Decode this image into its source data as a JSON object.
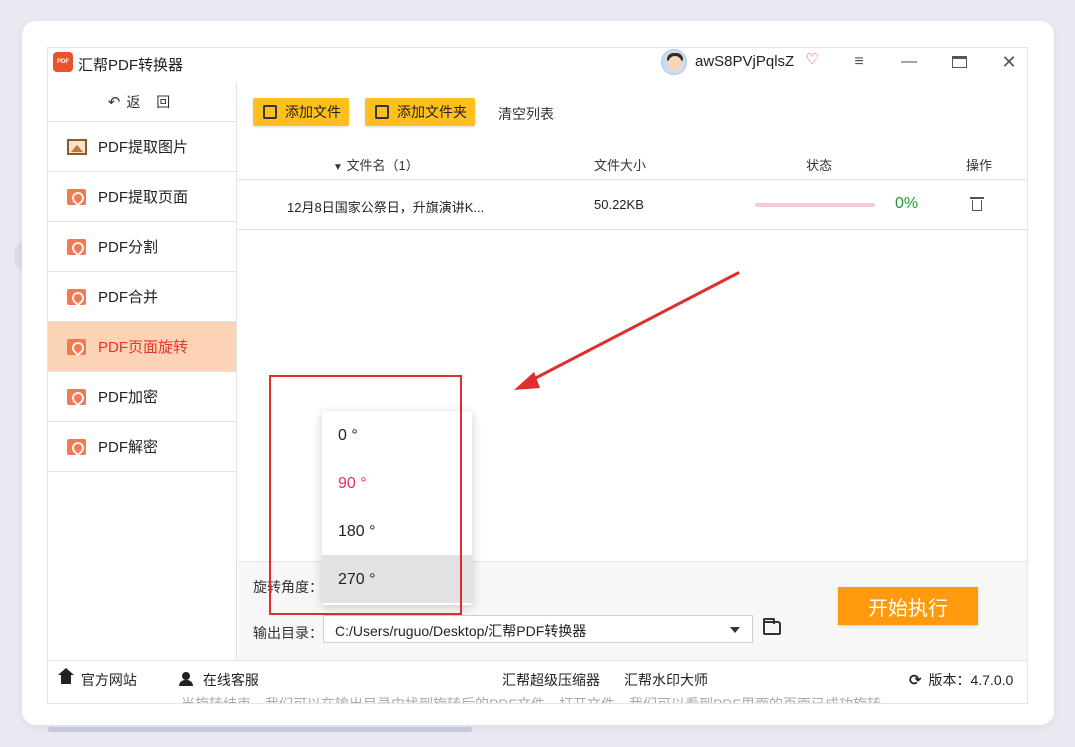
{
  "app": {
    "title": "汇帮PDF转换器",
    "logo_text": "PDF",
    "username": "awS8PVjPqlsZ"
  },
  "window_controls": {
    "menu": "≡",
    "minimize": "—",
    "close": "✕"
  },
  "sidebar": {
    "back_label": "返 回",
    "items": [
      {
        "label": "PDF提取图片",
        "icon": "image-icon",
        "active": false
      },
      {
        "label": "PDF提取页面",
        "icon": "pdf-icon",
        "active": false
      },
      {
        "label": "PDF分割",
        "icon": "pdf-icon",
        "active": false
      },
      {
        "label": "PDF合并",
        "icon": "pdf-icon",
        "active": false
      },
      {
        "label": "PDF页面旋转",
        "icon": "pdf-icon",
        "active": true
      },
      {
        "label": "PDF加密",
        "icon": "pdf-icon",
        "active": false
      },
      {
        "label": "PDF解密",
        "icon": "pdf-icon",
        "active": false
      }
    ]
  },
  "toolbar": {
    "add_file": "添加文件",
    "add_folder": "添加文件夹",
    "clear_list": "清空列表"
  },
  "table": {
    "headers": {
      "filename": "文件名（1）",
      "size": "文件大小",
      "status": "状态",
      "action": "操作"
    },
    "rows": [
      {
        "filename": "12月8日国家公祭日，升旗演讲K...",
        "size": "50.22KB",
        "progress_percent": 0,
        "status_text": "0%"
      }
    ]
  },
  "options": {
    "rotation_label": "旋转角度：",
    "rotation_options": [
      "0 °",
      "90 °",
      "180 °",
      "270 °"
    ],
    "rotation_selected": "90 °",
    "rotation_hovered": "270 °",
    "output_label": "输出目录：",
    "output_dir": "C:/Users/ruguo/Desktop/汇帮PDF转换器",
    "start_button": "开始执行"
  },
  "footer": {
    "website": "官方网站",
    "support": "在线客服",
    "compressor": "汇帮超级压缩器",
    "watermark": "汇帮水印大师",
    "version": "版本：4.7.0.0",
    "cut_text": "当旋转结束，我们可以在输出目录中找到旋转后的PDF文件，打开文件，我们可以看到PDF里面的页面已成功旋转"
  },
  "colors": {
    "accent_yellow": "#ffbf1f",
    "start_orange": "#ff9a0e",
    "active_bg": "#fcd3b4",
    "active_text": "#e8342c",
    "selected_option": "#e5306a",
    "progress_text": "#1f9a3a",
    "annotation_red": "#e02d2d"
  }
}
